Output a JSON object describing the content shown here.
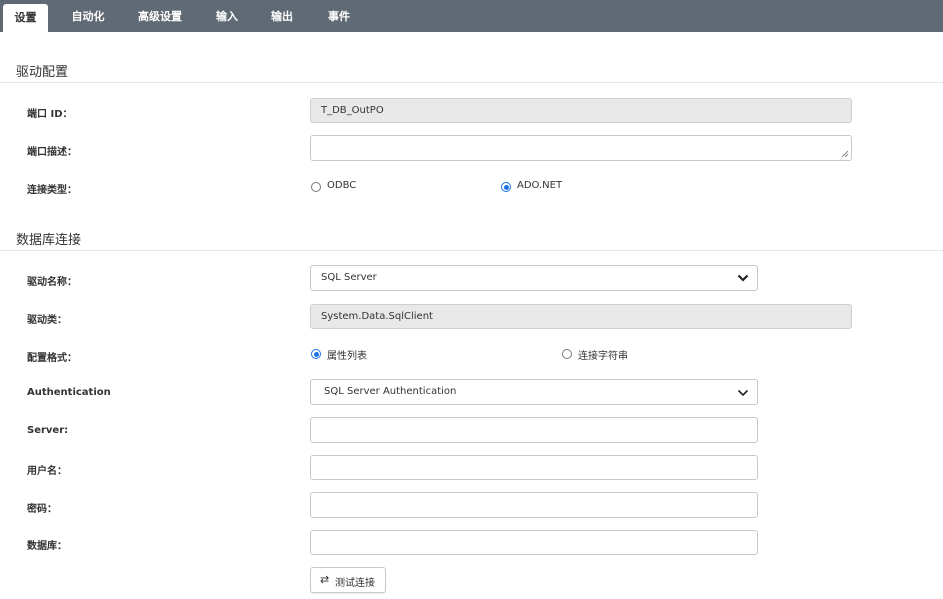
{
  "tabs": [
    {
      "label": "设置"
    },
    {
      "label": "自动化"
    },
    {
      "label": "高级设置"
    },
    {
      "label": "输入"
    },
    {
      "label": "输出"
    },
    {
      "label": "事件"
    }
  ],
  "driver_config": {
    "title": "驱动配置",
    "port_id_label": "端口 ID：",
    "port_id_value": "T_DB_OutPO",
    "port_desc_label": "端口描述：",
    "port_desc_value": "",
    "conn_type_label": "连接类型：",
    "conn_type_options": [
      "ODBC",
      "ADO.NET"
    ],
    "conn_type_selected": "ADO.NET"
  },
  "db_connection": {
    "title": "数据库连接",
    "driver_name_label": "驱动名称：",
    "driver_name_value": "SQL Server",
    "driver_class_label": "驱动类：",
    "driver_class_value": "System.Data.SqlClient",
    "config_format_label": "配置格式：",
    "config_format_options": [
      "属性列表",
      "连接字符串"
    ],
    "config_format_selected": "属性列表",
    "auth_label": "Authentication",
    "auth_value": "SQL Server Authentication",
    "server_label": "Server:",
    "server_value": "",
    "username_label": "用户名：",
    "username_value": "",
    "password_label": "密码：",
    "password_value": "",
    "database_label": "数据库：",
    "database_value": "",
    "test_button_label": "测试连接",
    "test_button_icon": "exchange-arrows-icon"
  },
  "colors": {
    "tabbar_bg": "#5f6a74",
    "radio_checked": "#1a73e8",
    "readonly_bg": "#e8e8e8"
  }
}
